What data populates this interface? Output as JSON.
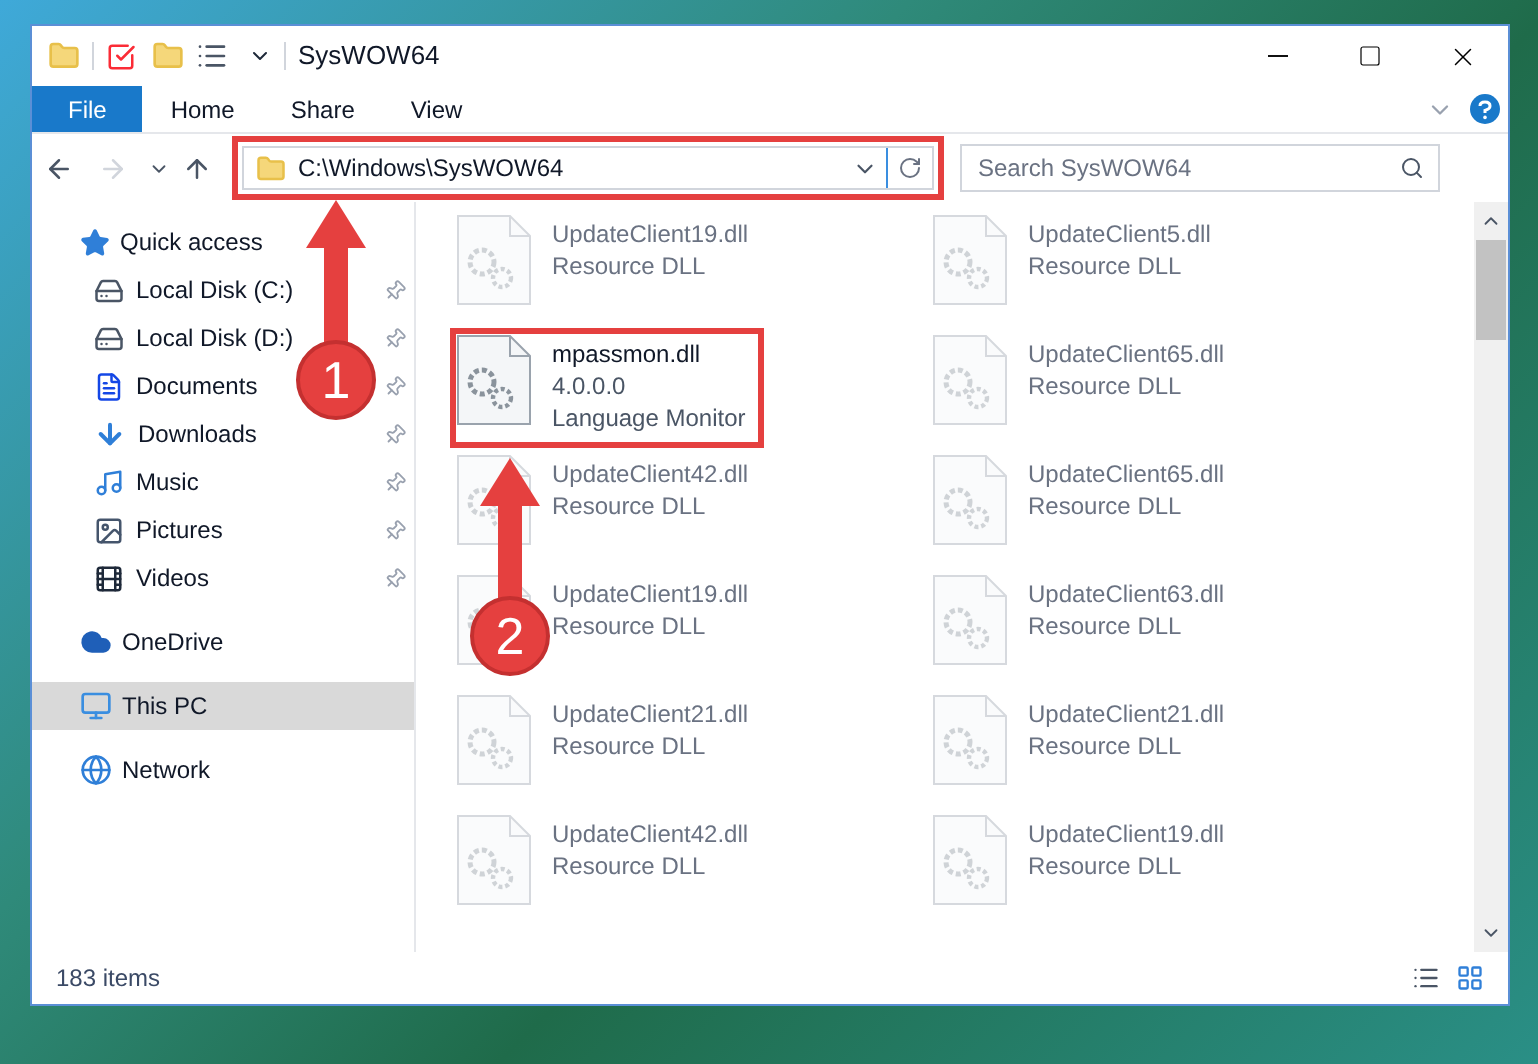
{
  "window": {
    "title": "SysWOW64"
  },
  "ribbon_tabs": [
    {
      "label": "File",
      "selected": true
    },
    {
      "label": "Home",
      "selected": false
    },
    {
      "label": "Share",
      "selected": false
    },
    {
      "label": "View",
      "selected": false
    }
  ],
  "address": {
    "path": "C:\\Windows\\SysWOW64",
    "highlighted": true
  },
  "search": {
    "placeholder": "Search SysWOW64"
  },
  "sidebar": {
    "items": [
      {
        "label": "Quick access",
        "selected": false,
        "children": [
          {
            "label": "Local Disk (C:)",
            "pinned": true
          },
          {
            "label": "Local Disk (D:)",
            "pinned": true
          },
          {
            "label": "Documents",
            "pinned": true
          },
          {
            "label": "Downloads",
            "pinned": true
          },
          {
            "label": "Music",
            "pinned": true
          },
          {
            "label": "Pictures",
            "pinned": true
          },
          {
            "label": "Videos",
            "pinned": true
          }
        ]
      },
      {
        "label": "OneDrive",
        "selected": false
      },
      {
        "label": "This PC",
        "selected": true
      },
      {
        "label": "Network",
        "selected": false
      }
    ]
  },
  "files": [
    {
      "name": "UpdateClient19.dll",
      "lines": [
        "Resource DLL"
      ],
      "blurred": true
    },
    {
      "name": "UpdateClient5.dll",
      "lines": [
        "Resource DLL"
      ],
      "blurred": true
    },
    {
      "name": "mpassmon.dll",
      "lines": [
        "4.0.0.0",
        "Language Monitor"
      ],
      "blurred": false,
      "highlighted": true
    },
    {
      "name": "UpdateClient65.dll",
      "lines": [
        "Resource DLL"
      ],
      "blurred": true
    },
    {
      "name": "UpdateClient42.dll",
      "lines": [
        "Resource DLL"
      ],
      "blurred": true
    },
    {
      "name": "UpdateClient65.dll",
      "lines": [
        "Resource DLL"
      ],
      "blurred": true
    },
    {
      "name": "UpdateClient19.dll",
      "lines": [
        "Resource DLL"
      ],
      "blurred": true
    },
    {
      "name": "UpdateClient63.dll",
      "lines": [
        "Resource DLL"
      ],
      "blurred": true
    },
    {
      "name": "UpdateClient21.dll",
      "lines": [
        "Resource DLL"
      ],
      "blurred": true
    },
    {
      "name": "UpdateClient21.dll",
      "lines": [
        "Resource DLL"
      ],
      "blurred": true
    },
    {
      "name": "UpdateClient42.dll",
      "lines": [
        "Resource DLL"
      ],
      "blurred": true
    },
    {
      "name": "UpdateClient19.dll",
      "lines": [
        "Resource DLL"
      ],
      "blurred": true
    }
  ],
  "status_bar": {
    "count": "183 items"
  },
  "annotations": [
    {
      "number": "1"
    },
    {
      "number": "2"
    }
  ]
}
